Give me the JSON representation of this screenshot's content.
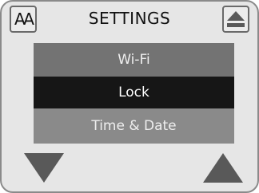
{
  "header": {
    "title": "SETTINGS",
    "font_icon": "font-size-icon",
    "font_icon_text": "AA",
    "eject_icon": "eject-icon"
  },
  "menu": {
    "items": [
      {
        "label": "Wi-Fi",
        "selected": false
      },
      {
        "label": "Lock",
        "selected": true
      },
      {
        "label": "Time & Date",
        "selected": false
      }
    ]
  },
  "footer": {
    "down_icon": "arrow-down-icon",
    "up_icon": "arrow-up-icon"
  },
  "colors": {
    "background": "#e6e6e6",
    "selected_row": "#161616",
    "row": "#787878",
    "icon": "#595959"
  }
}
